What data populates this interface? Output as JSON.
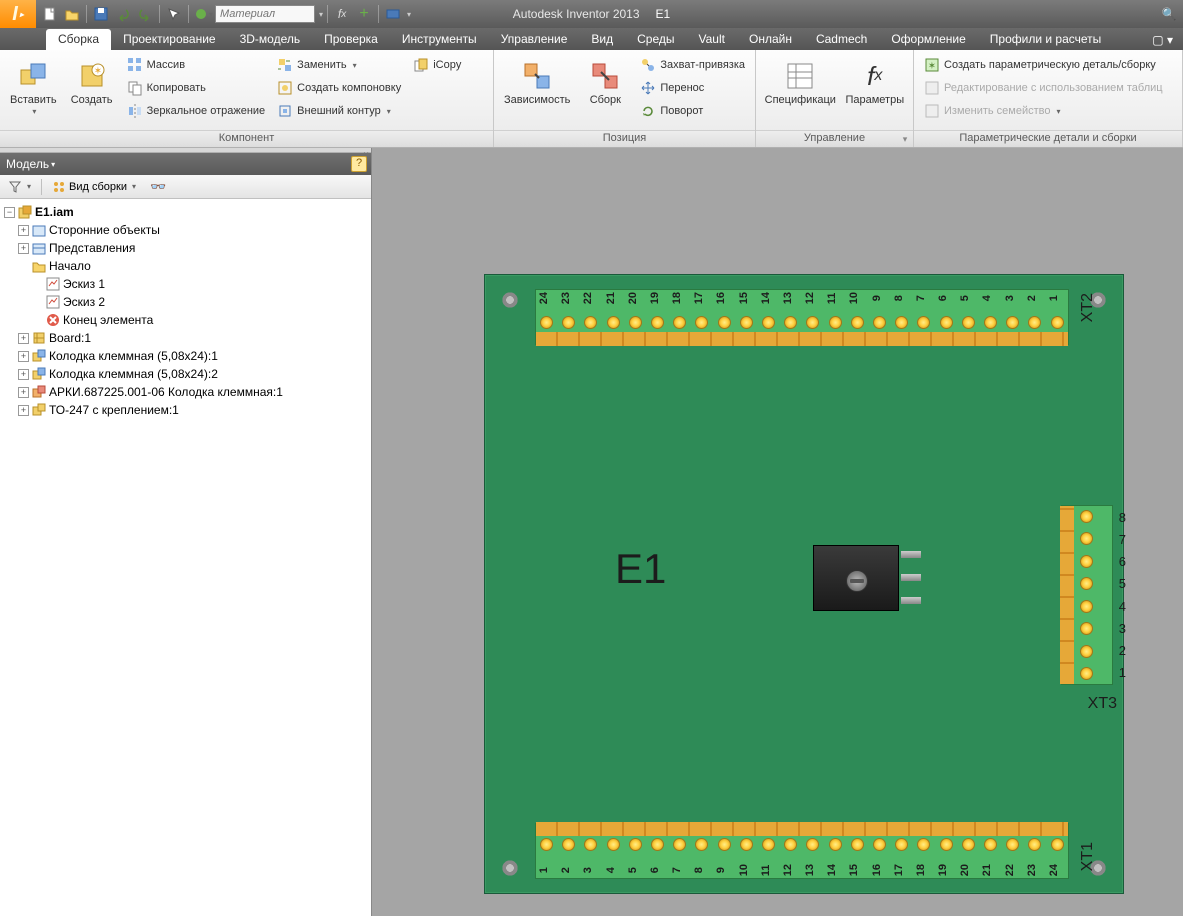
{
  "title": {
    "app": "Autodesk Inventor 2013",
    "doc": "E1"
  },
  "qat": {
    "material_placeholder": "Материал"
  },
  "menu": {
    "tabs": [
      "Сборка",
      "Проектирование",
      "3D-модель",
      "Проверка",
      "Инструменты",
      "Управление",
      "Вид",
      "Среды",
      "Vault",
      "Онлайн",
      "Cadmech",
      "Оформление",
      "Профили и расчеты"
    ],
    "active": 0
  },
  "ribbon": {
    "panels": {
      "component": {
        "label": "Компонент",
        "insert": "Вставить",
        "create": "Создать",
        "array": "Массив",
        "copy": "Копировать",
        "mirror": "Зеркальное отражение",
        "replace": "Заменить",
        "layout": "Создать компоновку",
        "contour": "Внешний контур",
        "icopy": "iCopy"
      },
      "position": {
        "label": "Позиция",
        "constrain": "Зависимость",
        "assemble": "Сборк",
        "grip": "Захват-привязка",
        "move": "Перенос",
        "rotate": "Поворот"
      },
      "manage": {
        "label": "Управление",
        "bom": "Спецификаци",
        "params": "Параметры"
      },
      "ipart": {
        "label": "Параметрические детали и сборки",
        "create": "Создать параметрическую деталь/сборку",
        "edit_table": "Редактирование с использованием таблиц",
        "edit_family": "Изменить семейство"
      }
    }
  },
  "sidebar": {
    "title": "Модель",
    "view_mode": "Вид сборки",
    "tree": {
      "root": "E1.iam",
      "items": [
        {
          "label": "Сторонние объекты",
          "exp": "+",
          "ico": "ext"
        },
        {
          "label": "Представления",
          "exp": "+",
          "ico": "rep"
        },
        {
          "label": "Начало",
          "exp": "",
          "ico": "folder"
        },
        {
          "label": "Эскиз 1",
          "exp": "",
          "ico": "sketch",
          "ind": 2
        },
        {
          "label": "Эскиз 2",
          "exp": "",
          "ico": "sketch",
          "ind": 2
        },
        {
          "label": "Конец элемента",
          "exp": "",
          "ico": "end",
          "ind": 2
        },
        {
          "label": "Board:1",
          "exp": "+",
          "ico": "part"
        },
        {
          "label": "Колодка клеммная (5,08x24):1",
          "exp": "+",
          "ico": "asm"
        },
        {
          "label": "Колодка клеммная (5,08x24):2",
          "exp": "+",
          "ico": "asm"
        },
        {
          "label": "АРКИ.687225.001-06 Колодка клеммная:1",
          "exp": "+",
          "ico": "asm2"
        },
        {
          "label": "ТО-247 с креплением:1",
          "exp": "+",
          "ico": "asm3"
        }
      ]
    }
  },
  "board": {
    "label": "E1",
    "xt1": {
      "label": "XT1",
      "start": 1,
      "end": 24,
      "reverse": false
    },
    "xt2": {
      "label": "XT2",
      "start": 1,
      "end": 24,
      "reverse": true
    },
    "xt3": {
      "label": "XT3",
      "start": 1,
      "end": 8,
      "reverse": true
    }
  }
}
